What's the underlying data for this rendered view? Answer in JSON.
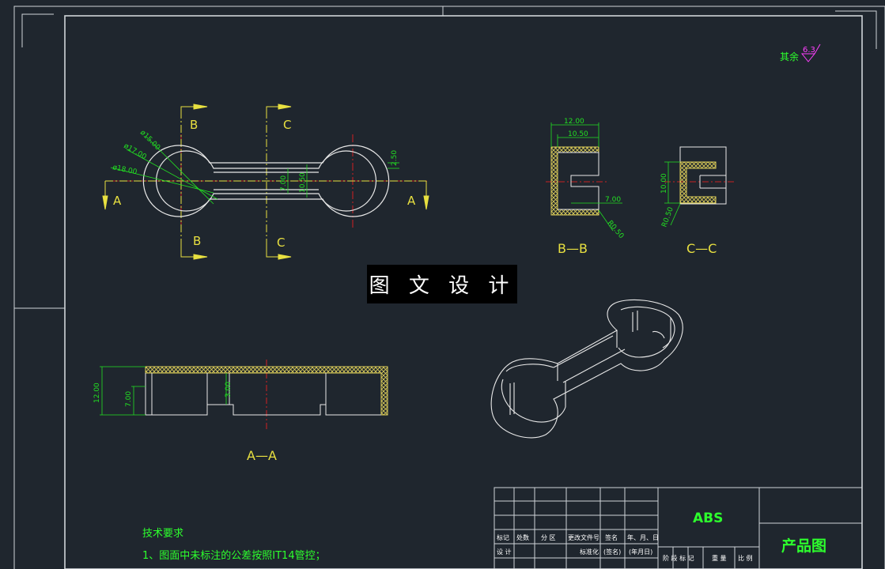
{
  "watermark": "图 文 设 计",
  "roughness": {
    "label": "其余",
    "value": "6.3"
  },
  "section_labels": {
    "a": "A",
    "b": "B",
    "c": "C"
  },
  "section_titles": {
    "aa": "A—A",
    "bb": "B—B",
    "cc": "C—C"
  },
  "dimensions": {
    "d15": "ø15.00",
    "d17": "ø17.00",
    "d18": "ø18.00",
    "w250": "2.50",
    "w700": "7.00",
    "w1050": "10.50",
    "bb_1200": "12.00",
    "bb_1050": "10.50",
    "bb_700": "7.00",
    "bb_r050": "R0.50",
    "cc_1000": "10.00",
    "cc_r050": "R0.50",
    "aa_1200": "12.00",
    "aa_700": "7.00",
    "aa_300": "3.00"
  },
  "tech_requirements": {
    "title": "技术要求",
    "item1": "1、图面中未标注的公差按照IT14管控；"
  },
  "title_block": {
    "material": "ABS",
    "drawing_name": "产品图",
    "headers": [
      "标记",
      "处数",
      "分 区",
      "更改文件号",
      "签名",
      "年、月、日"
    ],
    "row2": [
      "设 计",
      "",
      "",
      "标准化",
      "(签名)",
      "(年月日)"
    ],
    "stage_labels": [
      "阶 段 标 记",
      "重 量",
      "比 例"
    ]
  },
  "colors": {
    "background": "#1f262e",
    "frame": "#ffffff",
    "dimension": "#22e022",
    "section": "#e8e040",
    "center": "#ff2020",
    "title_text": "#2dff2d",
    "roughness_symbol": "#ff40ff"
  }
}
